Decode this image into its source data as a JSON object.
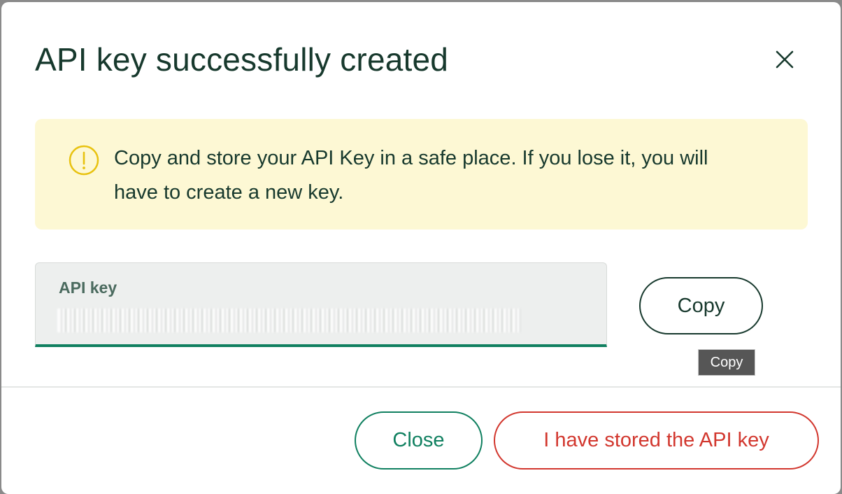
{
  "dialog": {
    "title": "API key successfully created",
    "close_icon": "close-icon"
  },
  "warning": {
    "icon": "warning-circle-icon",
    "message": "Copy and store your API Key in a safe place. If you lose it, you will have to create a new key."
  },
  "api_key_field": {
    "label": "API key",
    "value": "••••••••••••••••••••••••••••••••••••••••••••••••••••",
    "redacted": true
  },
  "copy": {
    "button_label": "Copy",
    "tooltip": "Copy"
  },
  "footer": {
    "close_label": "Close",
    "confirm_label": "I have stored the API key"
  },
  "colors": {
    "title_text": "#17392d",
    "warning_bg": "#fdf8d4",
    "warning_icon": "#e8c20f",
    "field_underline": "#108060",
    "close_button": "#108060",
    "confirm_button": "#d2372e",
    "tooltip_bg": "#565656"
  }
}
